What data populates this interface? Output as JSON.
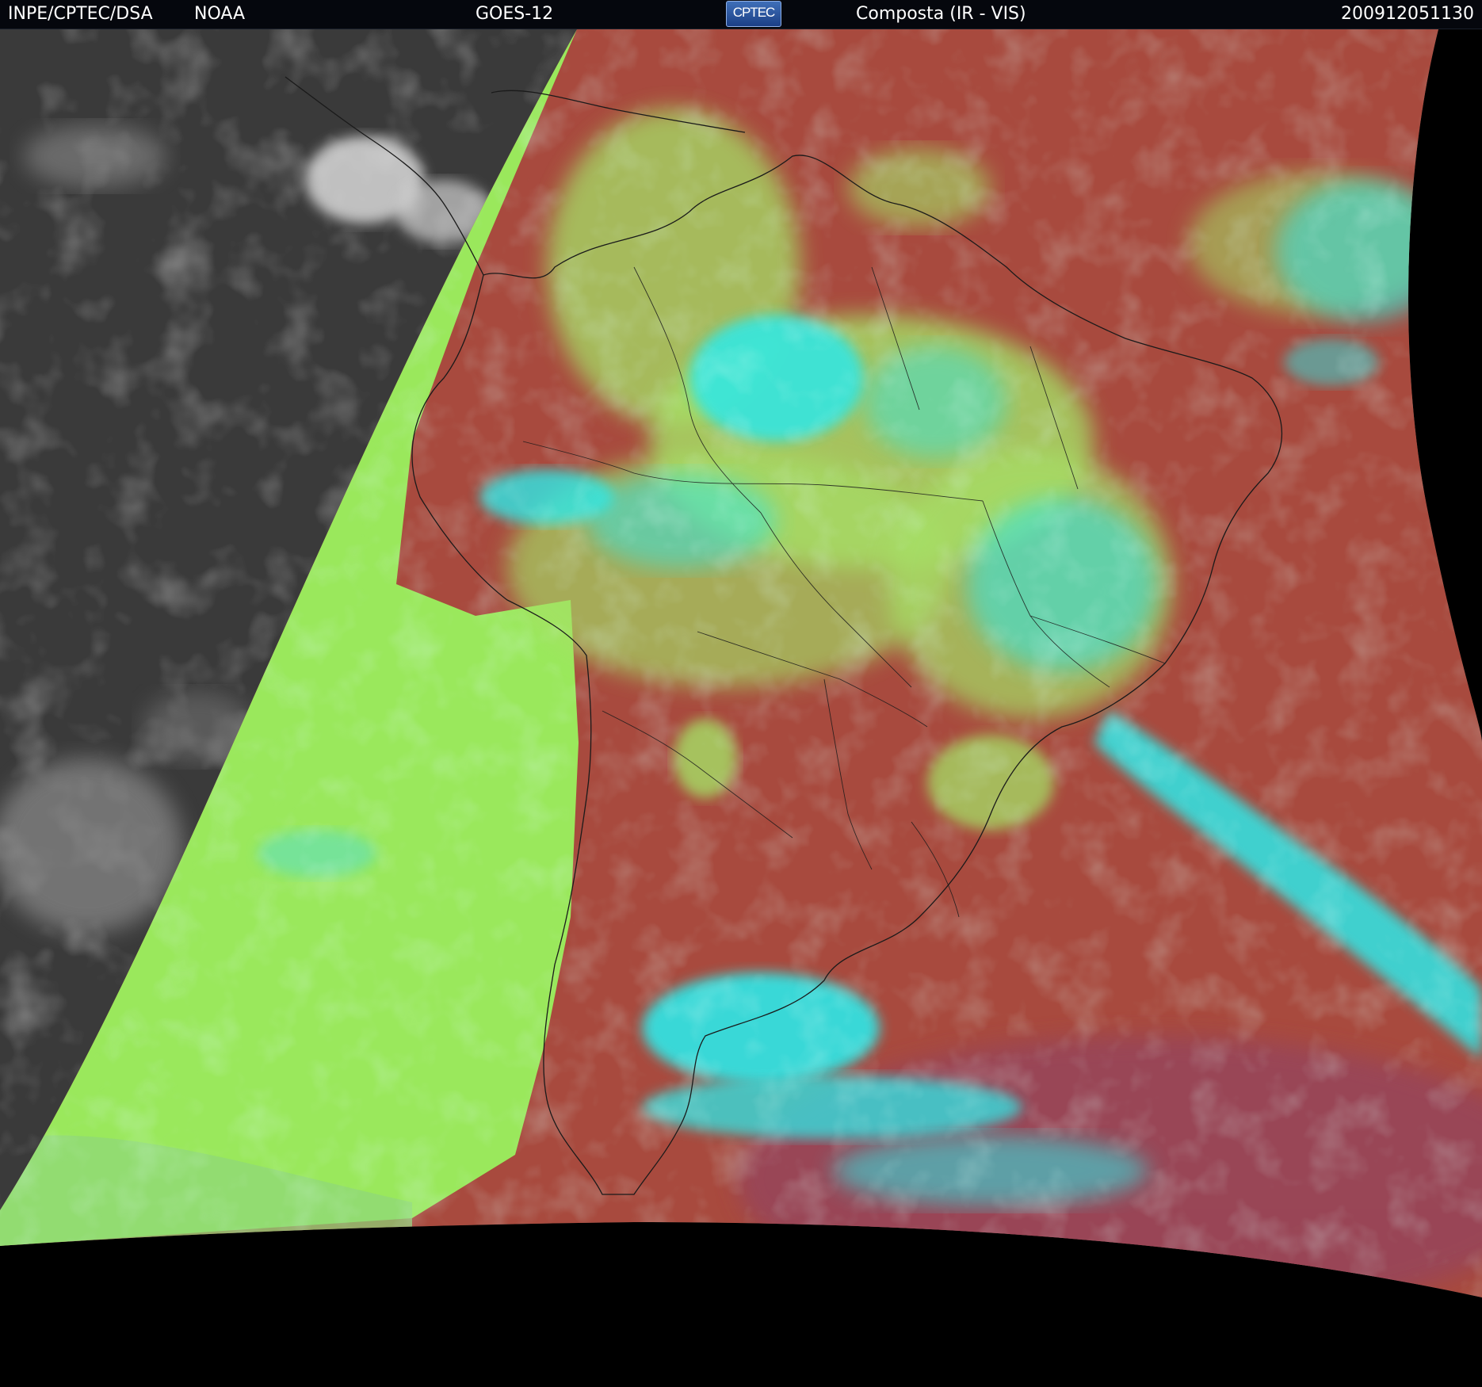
{
  "header": {
    "organization": "INPE/CPTEC/DSA",
    "agency": "NOAA",
    "satellite": "GOES-12",
    "logo_text": "CPTEC",
    "product": "Composta (IR - VIS)",
    "timestamp": "200912051130"
  },
  "colors": {
    "header_background": "#05070d",
    "header_text": "#ffffff",
    "ocean_warm": "#a84a3e",
    "ocean_clear_ir": "#9ae85c",
    "clouds_cold": "#2ee8e8",
    "clouds_mid": "#a6e066",
    "night_side": "#3a3a3a",
    "space": "#000000"
  }
}
